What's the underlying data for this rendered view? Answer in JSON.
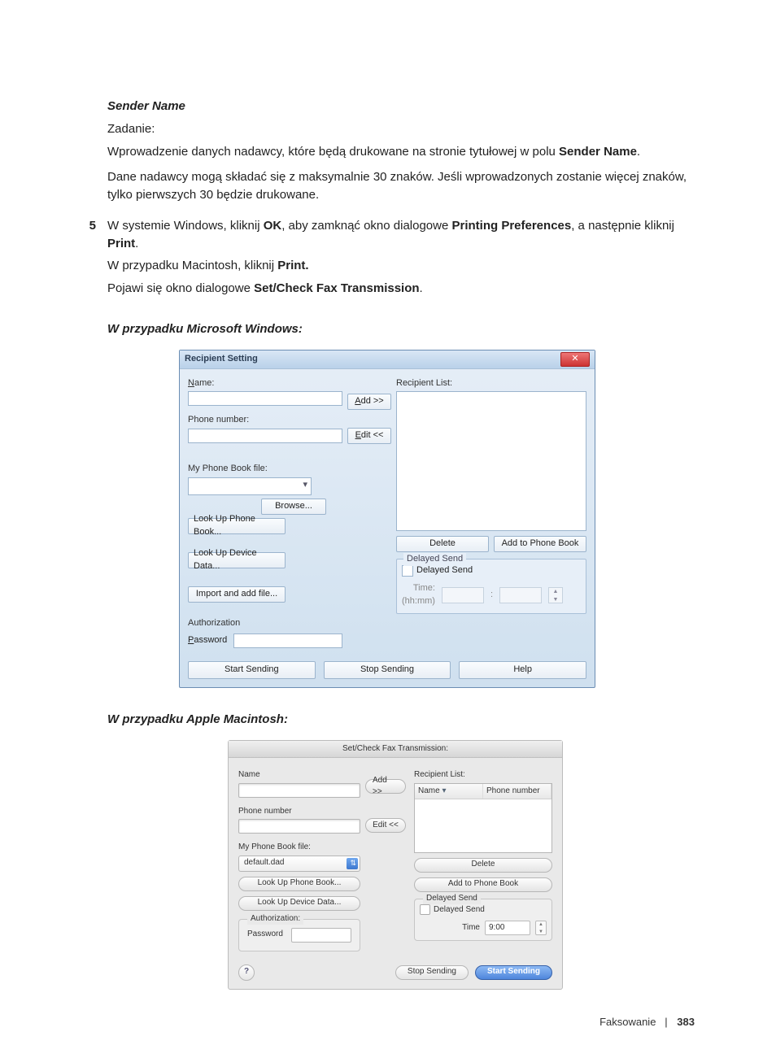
{
  "doc": {
    "sender_name_heading": "Sender Name",
    "task_label": "Zadanie:",
    "para1_a": "Wprowadzenie danych nadawcy, które będą drukowane na stronie tytułowej w polu ",
    "para1_bold": "Sender Name",
    "para1_b": ".",
    "para2": "Dane nadawcy mogą składać się z maksymalnie 30 znaków. Jeśli wprowadzonych zostanie więcej znaków, tylko pierwszych 30 będzie drukowane.",
    "step_num": "5",
    "step_a": "W systemie Windows, kliknij ",
    "step_ok": "OK",
    "step_b": ", aby zamknąć okno dialogowe ",
    "step_pp": "Printing Preferences",
    "step_c": ", a następnie kliknij ",
    "step_print": "Print",
    "step_d": ".",
    "step_mac_a": "W przypadku Macintosh, kliknij ",
    "step_mac_print": "Print.",
    "step3_a": "Pojawi się okno dialogowe ",
    "step3_bold": "Set/Check Fax Transmission",
    "step3_b": ".",
    "h_win": "W przypadku Microsoft Windows:",
    "h_mac": "W przypadku Apple Macintosh:"
  },
  "win": {
    "title": "Recipient Setting",
    "close": "✕",
    "name_label": "Name:",
    "phone_label": "Phone number:",
    "pbfile_label": "My Phone Book file:",
    "browse": "Browse...",
    "lookup_pb": "Look Up Phone Book...",
    "lookup_dev": "Look Up Device Data...",
    "import": "Import and add file...",
    "auth_label": "Authorization",
    "password_label": "Password",
    "add": "Add >>",
    "edit": "Edit <<",
    "recipient_list": "Recipient List:",
    "delete": "Delete",
    "add_to_pb": "Add to Phone Book",
    "delayed_group": "Delayed Send",
    "delayed_cb": "Delayed Send",
    "time_label": "Time:\n(hh:mm)",
    "start": "Start Sending",
    "stop": "Stop Sending",
    "help": "Help"
  },
  "mac": {
    "title": "Set/Check Fax Transmission:",
    "name_label": "Name",
    "phone_label": "Phone number",
    "pbfile_label": "My Phone Book file:",
    "pbfile_value": "default.dad",
    "lookup_pb": "Look Up Phone Book...",
    "lookup_dev": "Look Up Device Data...",
    "auth_label": "Authorization:",
    "password_label": "Password",
    "add": "Add >>",
    "edit": "Edit <<",
    "recipient_list": "Recipient List:",
    "th_name": "Name",
    "th_phone": "Phone number",
    "delete": "Delete",
    "add_to_pb": "Add to Phone Book",
    "delayed_group": "Delayed Send",
    "delayed_cb": "Delayed Send",
    "time_label": "Time",
    "time_value": "9:00",
    "help": "?",
    "stop": "Stop Sending",
    "start": "Start Sending"
  },
  "footer": {
    "section": "Faksowanie",
    "sep": "|",
    "page": "383"
  }
}
